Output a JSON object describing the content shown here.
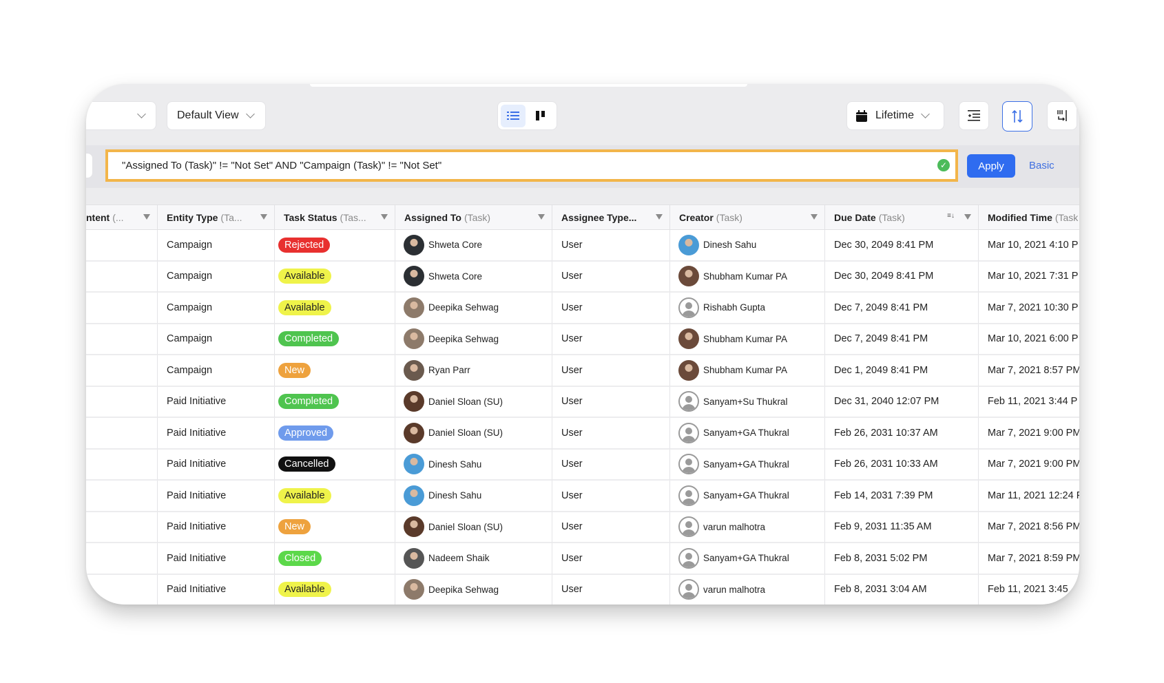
{
  "toolbar": {
    "view_select": "Default View",
    "date_range": "Lifetime",
    "icons": [
      "list-view-icon",
      "board-view-icon",
      "calendar-icon",
      "indent-icon",
      "sort-icon",
      "column-settings-icon"
    ]
  },
  "filter": {
    "query": "\"Assigned To (Task)\" != \"Not Set\" AND \"Campaign (Task)\" != \"Not Set\"",
    "apply_label": "Apply",
    "basic_label": "Basic",
    "valid_icon": "check-circle-icon"
  },
  "colors": {
    "accent": "#2f6cf0",
    "query_border": "#f2b54a",
    "valid": "#4cbb5a"
  },
  "status_colors": {
    "Rejected": {
      "bg": "#e8302f",
      "fg": "#ffffff"
    },
    "Available": {
      "bg": "#eff34a",
      "fg": "#222222"
    },
    "Completed": {
      "bg": "#4fc44f",
      "fg": "#ffffff"
    },
    "New": {
      "bg": "#eea23e",
      "fg": "#ffffff"
    },
    "Approved": {
      "bg": "#6f9bec",
      "fg": "#ffffff"
    },
    "Cancelled": {
      "bg": "#111111",
      "fg": "#ffffff"
    },
    "Closed": {
      "bg": "#5cd84a",
      "fg": "#ffffff"
    }
  },
  "table": {
    "columns": [
      {
        "label": "ntent",
        "sub": "(..."
      },
      {
        "label": "Entity Type",
        "sub": "(Ta..."
      },
      {
        "label": "Task Status",
        "sub": "(Tas..."
      },
      {
        "label": "Assigned To",
        "sub": "(Task)"
      },
      {
        "label": "Assignee Type...",
        "sub": ""
      },
      {
        "label": "Creator",
        "sub": "(Task)"
      },
      {
        "label": "Due Date",
        "sub": "(Task)",
        "sorted": true
      },
      {
        "label": "Modified Time",
        "sub": "(Task"
      }
    ],
    "rows": [
      {
        "entity": "Campaign",
        "status": "Rejected",
        "assigned": "Shweta Core",
        "atype": "User",
        "creator": "Dinesh Sahu",
        "due": "Dec 30, 2049 8:41 PM",
        "modified": "Mar 10, 2021 4:10 P"
      },
      {
        "entity": "Campaign",
        "status": "Available",
        "assigned": "Shweta Core",
        "atype": "User",
        "creator": "Shubham Kumar PA",
        "due": "Dec 30, 2049 8:41 PM",
        "modified": "Mar 10, 2021 7:31 P"
      },
      {
        "entity": "Campaign",
        "status": "Available",
        "assigned": "Deepika Sehwag",
        "atype": "User",
        "creator": "Rishabh Gupta",
        "due": "Dec 7, 2049 8:41 PM",
        "modified": "Mar 7, 2021 10:30 P"
      },
      {
        "entity": "Campaign",
        "status": "Completed",
        "assigned": "Deepika Sehwag",
        "atype": "User",
        "creator": "Shubham Kumar PA",
        "due": "Dec 7, 2049 8:41 PM",
        "modified": "Mar 10, 2021 6:00 P"
      },
      {
        "entity": "Campaign",
        "status": "New",
        "assigned": "Ryan Parr",
        "atype": "User",
        "creator": "Shubham Kumar PA",
        "due": "Dec 1, 2049 8:41 PM",
        "modified": "Mar 7, 2021 8:57 PM"
      },
      {
        "entity": "Paid Initiative",
        "status": "Completed",
        "assigned": "Daniel Sloan (SU)",
        "atype": "User",
        "creator": "Sanyam+Su Thukral",
        "due": "Dec 31, 2040 12:07 PM",
        "modified": "Feb 11, 2021 3:44 P"
      },
      {
        "entity": "Paid Initiative",
        "status": "Approved",
        "assigned": "Daniel Sloan (SU)",
        "atype": "User",
        "creator": "Sanyam+GA Thukral",
        "due": "Feb 26, 2031 10:37 AM",
        "modified": "Mar 7, 2021 9:00 PM"
      },
      {
        "entity": "Paid Initiative",
        "status": "Cancelled",
        "assigned": "Dinesh Sahu",
        "atype": "User",
        "creator": "Sanyam+GA Thukral",
        "due": "Feb 26, 2031 10:33 AM",
        "modified": "Mar 7, 2021 9:00 PM"
      },
      {
        "entity": "Paid Initiative",
        "status": "Available",
        "assigned": "Dinesh Sahu",
        "atype": "User",
        "creator": "Sanyam+GA Thukral",
        "due": "Feb 14, 2031 7:39 PM",
        "modified": "Mar 11, 2021 12:24 P"
      },
      {
        "entity": "Paid Initiative",
        "status": "New",
        "assigned": "Daniel Sloan (SU)",
        "atype": "User",
        "creator": "varun malhotra",
        "due": "Feb 9, 2031 11:35 AM",
        "modified": "Mar 7, 2021 8:56 PM"
      },
      {
        "entity": "Paid Initiative",
        "status": "Closed",
        "assigned": "Nadeem Shaik",
        "atype": "User",
        "creator": "Sanyam+GA Thukral",
        "due": "Feb 8, 2031 5:02 PM",
        "modified": "Mar 7, 2021 8:59 PM"
      },
      {
        "entity": "Paid Initiative",
        "status": "Available",
        "assigned": "Deepika Sehwag",
        "atype": "User",
        "creator": "varun malhotra",
        "due": "Feb 8, 2031 3:04 AM",
        "modified": "Feb 11, 2021 3:45"
      }
    ]
  }
}
